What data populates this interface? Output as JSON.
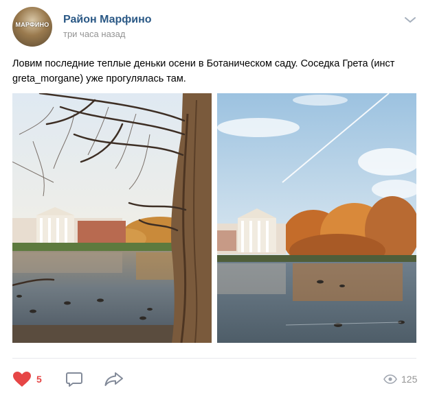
{
  "post": {
    "avatar_text": "МАРФИНО",
    "author": "Район Марфино",
    "time": "три часа назад",
    "text_lines": [
      "Ловим последние теплые деньки осени в Ботаническом саду. Соседка Грета (инст",
      "greta_morgane) уже прогулялась там."
    ],
    "photos": [
      {
        "icon": "photo-tree-pond-palace"
      },
      {
        "icon": "photo-autumn-pond-palace"
      }
    ]
  },
  "actions": {
    "like_icon": "heart-icon",
    "like_count": "5",
    "comment_icon": "comment-icon",
    "share_icon": "share-icon",
    "views_icon": "eye-icon",
    "views_count": "125"
  },
  "colors": {
    "link": "#2a5885",
    "muted": "#939393",
    "like": "#e64646",
    "divider": "#e7e8ec"
  }
}
